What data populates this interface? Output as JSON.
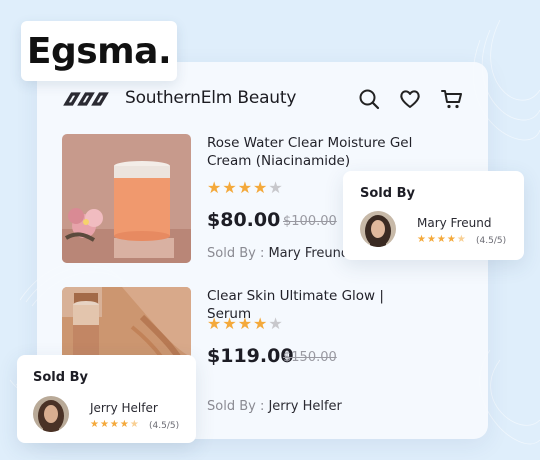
{
  "logo": {
    "text": "Egsma."
  },
  "shop": {
    "brand_name": "SouthernElm Beauty"
  },
  "nav": {
    "icons": [
      "search-icon",
      "heart-icon",
      "cart-icon"
    ]
  },
  "products": [
    {
      "title": "Rose Water Clear Moisture Gel Cream (Niacinamide)",
      "rating": 4,
      "max_rating": 5,
      "price": "$80.00",
      "old_price": "$100.00",
      "sold_by_label": "Sold By : ",
      "seller": "Mary Freund"
    },
    {
      "title": "Clear Skin Ultimate Glow | Serum",
      "rating": 4,
      "max_rating": 5,
      "price": "$119.00",
      "old_price": "$150.00",
      "sold_by_label": "Sold By : ",
      "seller": "Jerry Helfer"
    }
  ],
  "seller_cards": [
    {
      "title": "Sold By",
      "name": "Mary Freund",
      "stars": 4.5,
      "rating_text": "(4.5/5)"
    },
    {
      "title": "Sold By",
      "name": "Jerry Helfer",
      "stars": 4.5,
      "rating_text": "(4.5/5)"
    }
  ],
  "colors": {
    "star": "#f4a93b",
    "star_empty": "#c8c8cc",
    "background": "#dfeefb"
  }
}
